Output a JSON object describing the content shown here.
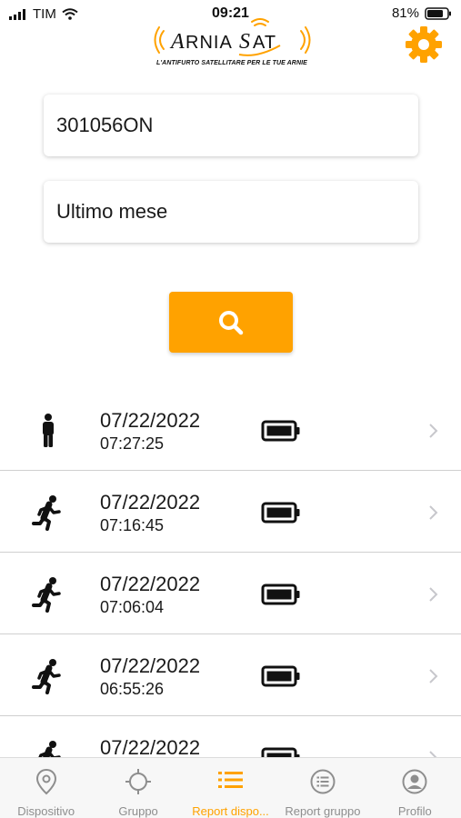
{
  "status_bar": {
    "carrier": "TIM",
    "time": "09:21",
    "battery_percent": "81%"
  },
  "header": {
    "logo_text": "ArniaSat",
    "tagline": "L'ANTIFURTO SATELLITARE PER LE TUE ARNIE",
    "settings_icon": "gear-icon",
    "accent_color": "#ffa200"
  },
  "form": {
    "device_value": "301056ON",
    "period_value": "Ultimo mese",
    "search_icon": "search-icon"
  },
  "reports": [
    {
      "date": "07/22/2022",
      "time": "07:27:25",
      "status_icon": "person-standing-icon",
      "battery_icon": "battery-full-icon"
    },
    {
      "date": "07/22/2022",
      "time": "07:16:45",
      "status_icon": "person-running-icon",
      "battery_icon": "battery-full-icon"
    },
    {
      "date": "07/22/2022",
      "time": "07:06:04",
      "status_icon": "person-running-icon",
      "battery_icon": "battery-full-icon"
    },
    {
      "date": "07/22/2022",
      "time": "06:55:26",
      "status_icon": "person-running-icon",
      "battery_icon": "battery-full-icon"
    },
    {
      "date": "07/22/2022",
      "time": "",
      "status_icon": "person-running-icon",
      "battery_icon": "battery-full-icon"
    }
  ],
  "tabs": [
    {
      "label": "Dispositivo",
      "icon": "location-pin-icon",
      "active": false
    },
    {
      "label": "Gruppo",
      "icon": "crosshair-icon",
      "active": false
    },
    {
      "label": "Report dispo...",
      "icon": "list-icon",
      "active": true
    },
    {
      "label": "Report gruppo",
      "icon": "list-circle-icon",
      "active": false
    },
    {
      "label": "Profilo",
      "icon": "user-icon",
      "active": false
    }
  ]
}
